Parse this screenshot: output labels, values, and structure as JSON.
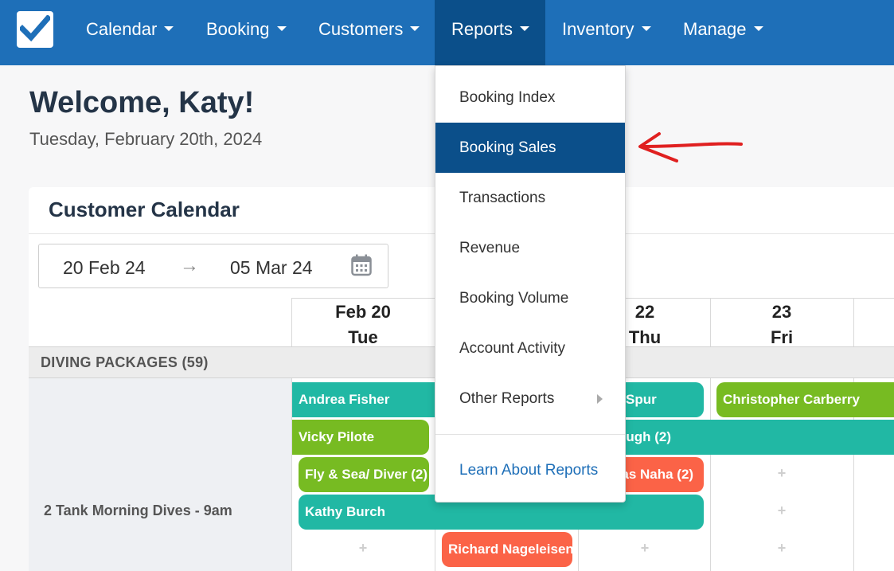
{
  "nav": {
    "logo_icon": "checkbox-icon",
    "items": [
      {
        "label": "Calendar"
      },
      {
        "label": "Booking"
      },
      {
        "label": "Customers"
      },
      {
        "label": "Reports"
      },
      {
        "label": "Inventory"
      },
      {
        "label": "Manage"
      }
    ],
    "active": "Reports",
    "bar_color": "#1e6fb8",
    "active_color": "#0b4f8a"
  },
  "welcome": {
    "title": "Welcome, Katy!",
    "date": "Tuesday, February 20th, 2024"
  },
  "calendar": {
    "title": "Customer Calendar",
    "range_start": "20 Feb 24",
    "range_arrow": "→",
    "range_end": "05 Mar 24",
    "calendar_icon": "calendar-icon",
    "days": [
      {
        "date": "Feb 20",
        "weekday": "Tue"
      },
      {
        "date": "22",
        "weekday": "Thu"
      },
      {
        "date": "23",
        "weekday": "Fri"
      }
    ],
    "section": "DIVING PACKAGES (59)",
    "row_label": "2 Tank Morning Dives - 9am",
    "bookings": [
      {
        "name": "Andrea Fisher",
        "color": "#21b8a4"
      },
      {
        "name": "Spur",
        "color": "#21b8a4"
      },
      {
        "name": "Christopher Carberry",
        "color": "#77bb22"
      },
      {
        "name": "Vicky Pilote",
        "color": "#77bb22"
      },
      {
        "name": "ough (2)",
        "color": "#21b8a4"
      },
      {
        "name": "Fly & Sea/ Diver (2)",
        "color": "#77bb22"
      },
      {
        "name": "nas Naha (2)",
        "color": "#fb6347"
      },
      {
        "name": "Kathy Burch",
        "color": "#21b8a4"
      },
      {
        "name": "Richard Nageleisen",
        "color": "#fb6347"
      }
    ],
    "add_glyph": "+"
  },
  "reports_menu": {
    "items": [
      {
        "label": "Booking Index"
      },
      {
        "label": "Booking Sales"
      },
      {
        "label": "Transactions"
      },
      {
        "label": "Revenue"
      },
      {
        "label": "Booking Volume"
      },
      {
        "label": "Account Activity"
      },
      {
        "label": "Other Reports"
      }
    ],
    "selected": "Booking Sales",
    "submenu_icon": "chevron-right-icon",
    "learn_link": "Learn About Reports"
  },
  "annotation": {
    "icon": "red-arrow-icon",
    "color": "#e02020"
  }
}
